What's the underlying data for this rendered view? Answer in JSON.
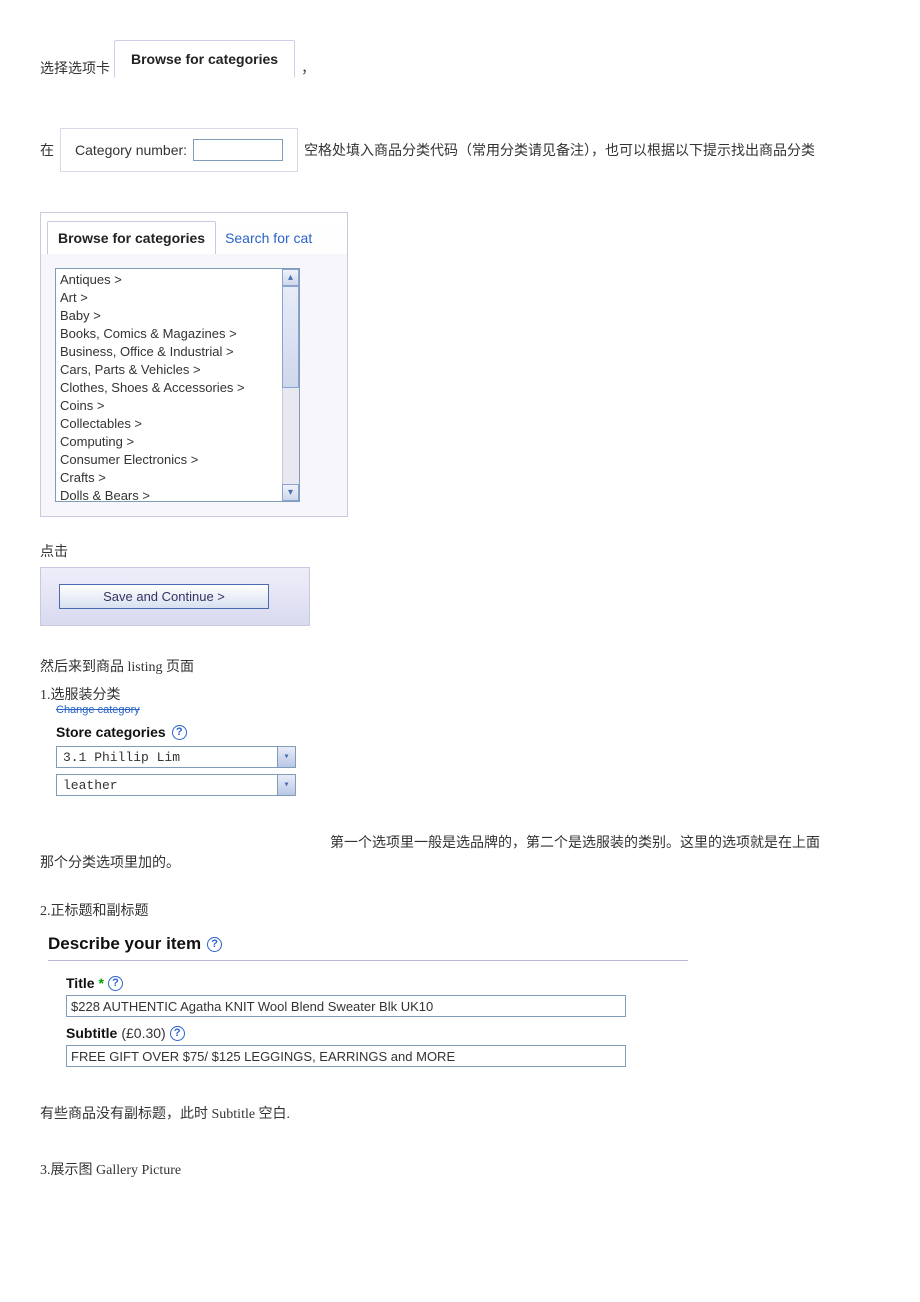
{
  "line1": {
    "prefix": "选择选项卡",
    "tab_label": "Browse for categories",
    "suffix": "，"
  },
  "line2": {
    "prefix": "在",
    "catnum_label": "Category number:",
    "catnum_value": "",
    "suffix": "空格处填入商品分类代码（常用分类请见备注），也可以根据以下提示找出商品分类"
  },
  "browse_panel": {
    "tab_a": "Browse for categories",
    "tab_b": "Search for cat",
    "items": [
      "Antiques >",
      "Art >",
      "Baby >",
      "Books, Comics & Magazines >",
      "Business, Office & Industrial >",
      "Cars, Parts & Vehicles >",
      "Clothes, Shoes & Accessories >",
      "Coins >",
      "Collectables >",
      "Computing >",
      "Consumer Electronics >",
      "Crafts >",
      "Dolls & Bears >"
    ]
  },
  "click_label": "点击",
  "save_button": "Save and Continue >",
  "para_listing": "然后来到商品 listing 页面",
  "para_step1": "1.选服装分类",
  "change_category_link": "Change category",
  "store_categories": {
    "heading": "Store categories",
    "dd1": "3.1 Phillip Lim",
    "dd2": "leather"
  },
  "para_note1a": "第一个选项里一般是选品牌的，第二个是选服装的类别。这里的选项就是在上面",
  "para_note1b": "那个分类选项里加的。",
  "para_step2": "2.正标题和副标题",
  "describe_heading": "Describe your item",
  "title_field": {
    "label": "Title",
    "value": "$228 AUTHENTIC Agatha KNIT Wool Blend Sweater Blk UK10"
  },
  "subtitle_field": {
    "label": "Subtitle",
    "price": "(£0.30)",
    "value": "FREE GIFT OVER $75/ $125 LEGGINGS, EARRINGS and MORE"
  },
  "para_nosubtitle": "有些商品没有副标题，此时 Subtitle 空白.",
  "para_step3": "3.展示图 Gallery Picture"
}
